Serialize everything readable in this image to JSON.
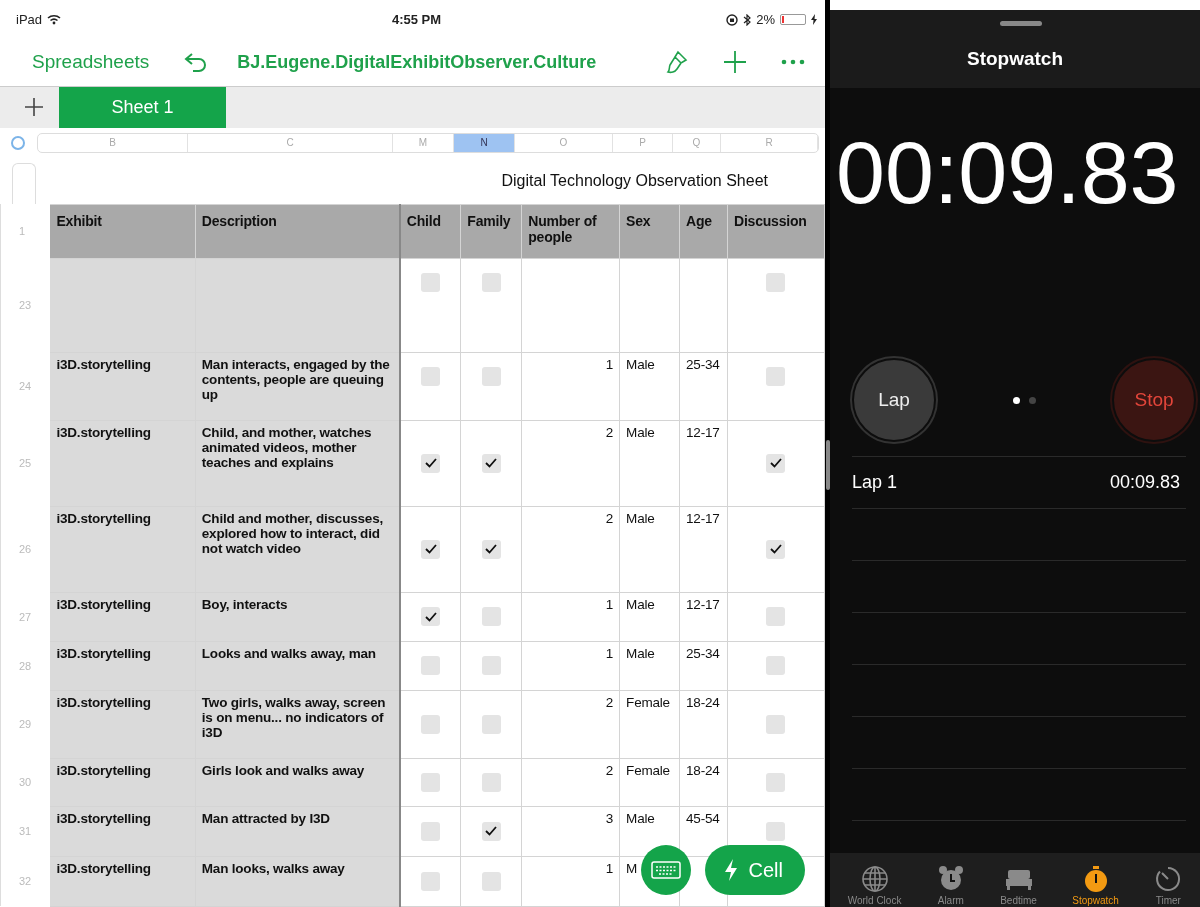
{
  "status_bar": {
    "device": "iPad",
    "time": "4:55 PM",
    "battery": "2%"
  },
  "toolbar": {
    "back_label": "Spreadsheets",
    "title": "BJ.Eugene.DigitalExhibitObserver.Culture"
  },
  "sheet_tabs": [
    {
      "label": "Sheet 1",
      "selected": true
    }
  ],
  "column_letters": [
    {
      "label": "B",
      "selected": false
    },
    {
      "label": "C",
      "selected": false
    },
    {
      "label": "M",
      "selected": false
    },
    {
      "label": "N",
      "selected": true
    },
    {
      "label": "O",
      "selected": false
    },
    {
      "label": "P",
      "selected": false
    },
    {
      "label": "Q",
      "selected": false
    },
    {
      "label": "R",
      "selected": false
    }
  ],
  "sheet": {
    "title": "Digital Technology Observation Sheet",
    "header_row_number": "1",
    "headers": [
      "Exhibit",
      "Description",
      "Child",
      "Family",
      "Number of people",
      "Sex",
      "Age",
      "Discussion"
    ],
    "rows": [
      {
        "row_number": "23",
        "child": false,
        "family": false,
        "discussion": false
      },
      {
        "row_number": "24",
        "exhibit": "i3D.storytelling",
        "description": "Man interacts, engaged by the contents, people are queuing up",
        "child": false,
        "family": false,
        "number": "1",
        "sex": "Male",
        "age": "25-34",
        "discussion": false
      },
      {
        "row_number": "25",
        "exhibit": "i3D.storytelling",
        "description": "Child, and mother, watches animated videos, mother teaches and explains",
        "child": true,
        "family": true,
        "number": "2",
        "sex": "Male",
        "age": "12-17",
        "discussion": true
      },
      {
        "row_number": "26",
        "exhibit": "i3D.storytelling",
        "description": "Child and mother, discusses, explored how to interact, did not watch video",
        "child": true,
        "family": true,
        "number": "2",
        "sex": "Male",
        "age": "12-17",
        "discussion": true
      },
      {
        "row_number": "27",
        "exhibit": "i3D.storytelling",
        "description": "Boy, interacts",
        "child": true,
        "family": false,
        "number": "1",
        "sex": "Male",
        "age": "12-17",
        "discussion": false
      },
      {
        "row_number": "28",
        "exhibit": "i3D.storytelling",
        "description": "Looks and walks away, man",
        "child": false,
        "family": false,
        "number": "1",
        "sex": "Male",
        "age": "25-34",
        "discussion": false
      },
      {
        "row_number": "29",
        "exhibit": "i3D.storytelling",
        "description": "Two girls, walks away, screen is on menu... no indicators of i3D",
        "child": false,
        "family": false,
        "number": "2",
        "sex": "Female",
        "age": "18-24",
        "discussion": false
      },
      {
        "row_number": "30",
        "exhibit": "i3D.storytelling",
        "description": "Girls look and walks away",
        "child": false,
        "family": false,
        "number": "2",
        "sex": "Female",
        "age": "18-24",
        "discussion": false
      },
      {
        "row_number": "31",
        "exhibit": "i3D.storytelling",
        "description": "Man attracted by I3D",
        "child": false,
        "family": true,
        "number": "3",
        "sex": "Male",
        "age": "45-54",
        "discussion": false
      },
      {
        "row_number": "32",
        "exhibit": "i3D.storytelling",
        "description": "Man looks, walks away",
        "child": false,
        "family": false,
        "number": "1",
        "sex": "M"
      }
    ]
  },
  "floating": {
    "cell_button": "Cell"
  },
  "stopwatch": {
    "title": "Stopwatch",
    "time": "00:09.83",
    "lap_button": "Lap",
    "stop_button": "Stop",
    "page_dots": [
      {
        "selected": true
      },
      {
        "selected": false
      }
    ],
    "laps": [
      {
        "label": "Lap 1",
        "time": "00:09.83"
      }
    ],
    "tabs": [
      {
        "kind": "globe",
        "label": "World Clock",
        "selected": false
      },
      {
        "kind": "alarm",
        "label": "Alarm",
        "selected": false
      },
      {
        "kind": "bed",
        "label": "Bedtime",
        "selected": false
      },
      {
        "kind": "stopwatch",
        "label": "Stopwatch",
        "selected": true
      },
      {
        "kind": "timer",
        "label": "Timer",
        "selected": false
      }
    ]
  }
}
